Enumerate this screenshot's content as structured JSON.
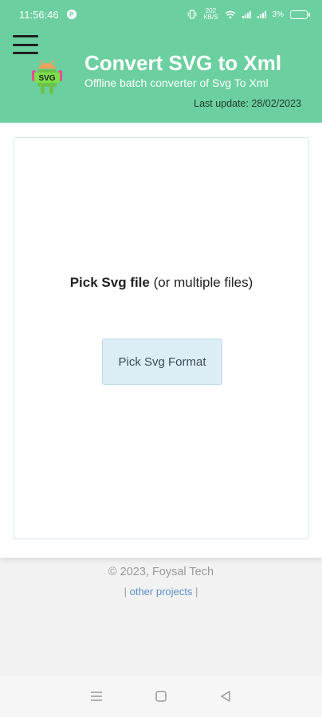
{
  "status_bar": {
    "time": "11:56:46",
    "notification_icon": "p-icon",
    "net_speed": "202\nKB/S",
    "battery": "3%"
  },
  "header": {
    "title": "Convert SVG to Xml",
    "subtitle": "Offline batch converter of Svg To Xml",
    "last_update": "Last update: 28/02/2023",
    "logo_text": "SVG"
  },
  "main": {
    "pick_label_bold": "Pick Svg file",
    "pick_label_rest": " (or multiple files)",
    "pick_button": "Pick Svg Format"
  },
  "footer": {
    "copyright": "© 2023, Foysal Tech",
    "sep_left": "|",
    "other_projects": "other projects",
    "sep_right": "|"
  },
  "colors": {
    "header_bg": "#6ccf9f",
    "button_bg": "#dcedf6",
    "link": "#5b8fc9"
  }
}
